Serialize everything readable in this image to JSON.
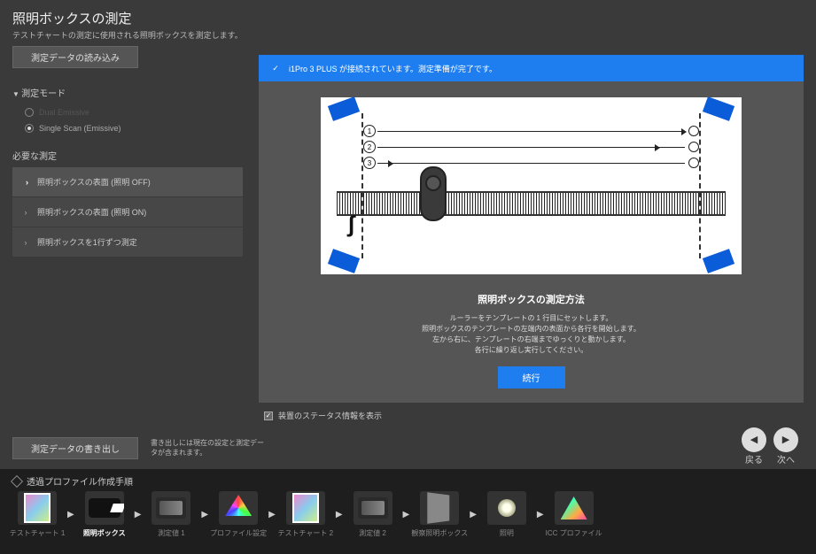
{
  "header": {
    "title": "照明ボックスの測定",
    "subtitle": "テストチャートの測定に使用される照明ボックスを測定します。"
  },
  "buttons": {
    "load": "測定データの読み込み",
    "export": "測定データの書き出し",
    "continue": "続行"
  },
  "mode": {
    "section": "測定モード",
    "opt1": "Dual Emissive",
    "opt2": "Single Scan (Emissive)"
  },
  "required": {
    "section": "必要な測定",
    "items": [
      "照明ボックスの表面 (照明 OFF)",
      "照明ボックスの表面 (照明 ON)",
      "照明ボックスを1行ずつ測定"
    ]
  },
  "status": {
    "text": "i1Pro 3 PLUS が接続されています。測定準備が完了です。"
  },
  "diagram": {
    "n1": "1",
    "n2": "2",
    "n3": "3"
  },
  "instructions": {
    "title": "照明ボックスの測定方法",
    "l1": "ルーラーをテンプレートの 1 行目にセットします。",
    "l2": "照明ボックスのテンプレートの左端内の表面から各行を開始します。",
    "l3": "左から右に、テンプレートの右端までゆっくりと動かします。",
    "l4": "各行に繰り返し実行してください。"
  },
  "checkbox": {
    "label": "装置のステータス情報を表示"
  },
  "export_note": "書き出しには現在の設定と測定データが含まれます。",
  "nav": {
    "back": "戻る",
    "next": "次へ"
  },
  "footer": {
    "title": "透過プロファイル作成手順",
    "steps": [
      "テストチャート 1",
      "照明ボックス",
      "測定値 1",
      "プロファイル設定",
      "テストチャート 2",
      "測定値 2",
      "観察照明ボックス",
      "照明",
      "ICC プロファイル"
    ]
  }
}
